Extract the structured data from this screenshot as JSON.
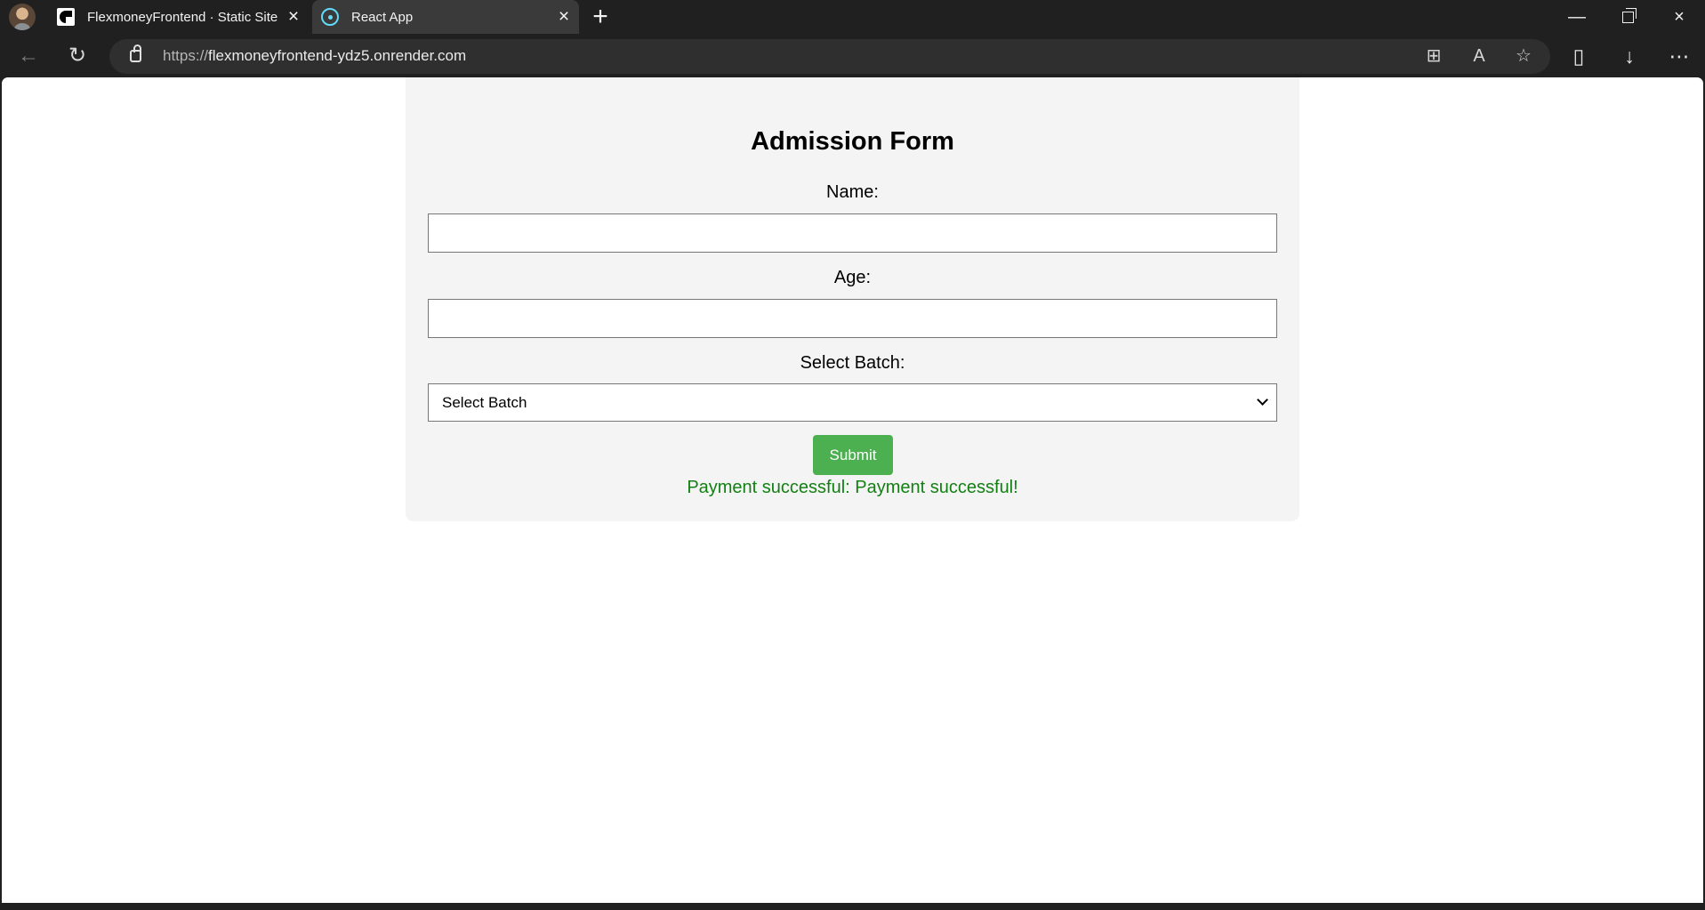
{
  "browser": {
    "tabs": [
      {
        "label": "FlexmoneyFrontend · Static Site",
        "close": "×",
        "icon": "render-icon"
      },
      {
        "label": "React App",
        "close": "×",
        "icon": "react-icon"
      }
    ],
    "new_tab": "+",
    "window": {
      "minimize": "—",
      "restore": "",
      "close": "×"
    },
    "address": {
      "protocol": "https://",
      "host": "flexmoneyfrontend-ydz5.onrender.com"
    },
    "toolbar": {
      "apps": "⊞",
      "read_aloud": "A",
      "favorite": "☆",
      "split": "▯",
      "download": "↓",
      "more": "⋯"
    },
    "nav": {
      "back": "←",
      "reload": "↻"
    }
  },
  "form": {
    "title": "Admission Form",
    "name_label": "Name:",
    "name_value": "",
    "age_label": "Age:",
    "age_value": "",
    "batch_label": "Select Batch:",
    "batch_value": "Select Batch",
    "submit_label": "Submit",
    "message": "Payment successful: Payment successful!",
    "colors": {
      "submit": "#4caf50",
      "message": "#138013",
      "card": "#f4f4f4"
    }
  }
}
